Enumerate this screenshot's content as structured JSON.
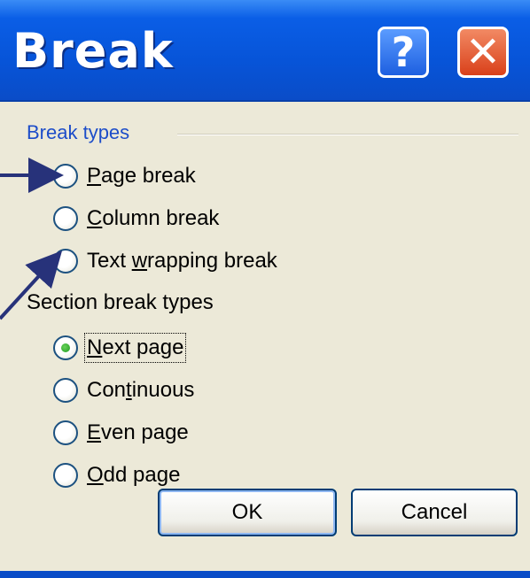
{
  "window": {
    "title": "Break",
    "help_label": "?",
    "close_label": "✕"
  },
  "break_types": {
    "group_label": "Break types",
    "options": [
      {
        "label": "Page break",
        "mnemonic": "P",
        "checked": false
      },
      {
        "label": "Column break",
        "mnemonic": "C",
        "checked": false
      },
      {
        "label": "Text wrapping break",
        "mnemonic": "w",
        "checked": false
      }
    ]
  },
  "section_break_types": {
    "group_label": "Section break types",
    "options": [
      {
        "label": "Next page",
        "mnemonic": "N",
        "checked": true
      },
      {
        "label": "Continuous",
        "mnemonic": "t",
        "checked": false
      },
      {
        "label": "Even page",
        "mnemonic": "E",
        "checked": false
      },
      {
        "label": "Odd page",
        "mnemonic": "O",
        "checked": false
      }
    ]
  },
  "buttons": {
    "ok": "OK",
    "cancel": "Cancel"
  },
  "colors": {
    "titlebar": "#0754d8",
    "group_label": "#1d4dc9",
    "dialog_bg": "#ece9d8",
    "annotation_arrow": "#27327a"
  },
  "icons": {
    "help": "help-icon",
    "close": "close-icon",
    "arrows": "annotation-arrow-icon"
  }
}
